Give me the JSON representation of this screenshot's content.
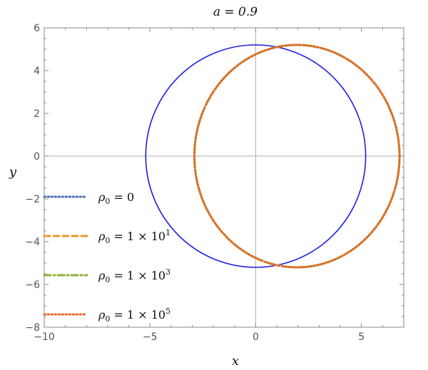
{
  "chart_data": {
    "type": "line",
    "title": "a = 0.9",
    "xlabel": "x",
    "ylabel": "y",
    "xlim": [
      -10,
      7
    ],
    "ylim": [
      -8,
      6
    ],
    "xticks": [
      -10,
      -5,
      0,
      5
    ],
    "yticks": [
      -8,
      -6,
      -4,
      -2,
      0,
      2,
      4,
      6
    ],
    "grid": false,
    "legend_position": "left",
    "reference_circle": {
      "color": "#1f1fe0",
      "center": [
        0,
        0
      ],
      "radius": 5.2
    },
    "series": [
      {
        "name": "ρ0 = 0",
        "color": "#4a6fb5",
        "dash": "dotted",
        "center": [
          1.95,
          0
        ],
        "radius_x": 4.85,
        "radius_y": 5.2
      },
      {
        "name": "ρ0 = 1 × 10^1",
        "color": "#e89b2b",
        "dash": "dashed",
        "center": [
          1.95,
          0
        ],
        "radius_x": 4.85,
        "radius_y": 5.2
      },
      {
        "name": "ρ0 = 1 × 10^3",
        "color": "#8cb23a",
        "dash": "dashdot",
        "center": [
          1.95,
          0
        ],
        "radius_x": 4.85,
        "radius_y": 5.2
      },
      {
        "name": "ρ0 = 1 × 10^5",
        "color": "#e8682b",
        "dash": "dotted",
        "center": [
          1.95,
          0
        ],
        "radius_x": 4.85,
        "radius_y": 5.2
      }
    ]
  }
}
